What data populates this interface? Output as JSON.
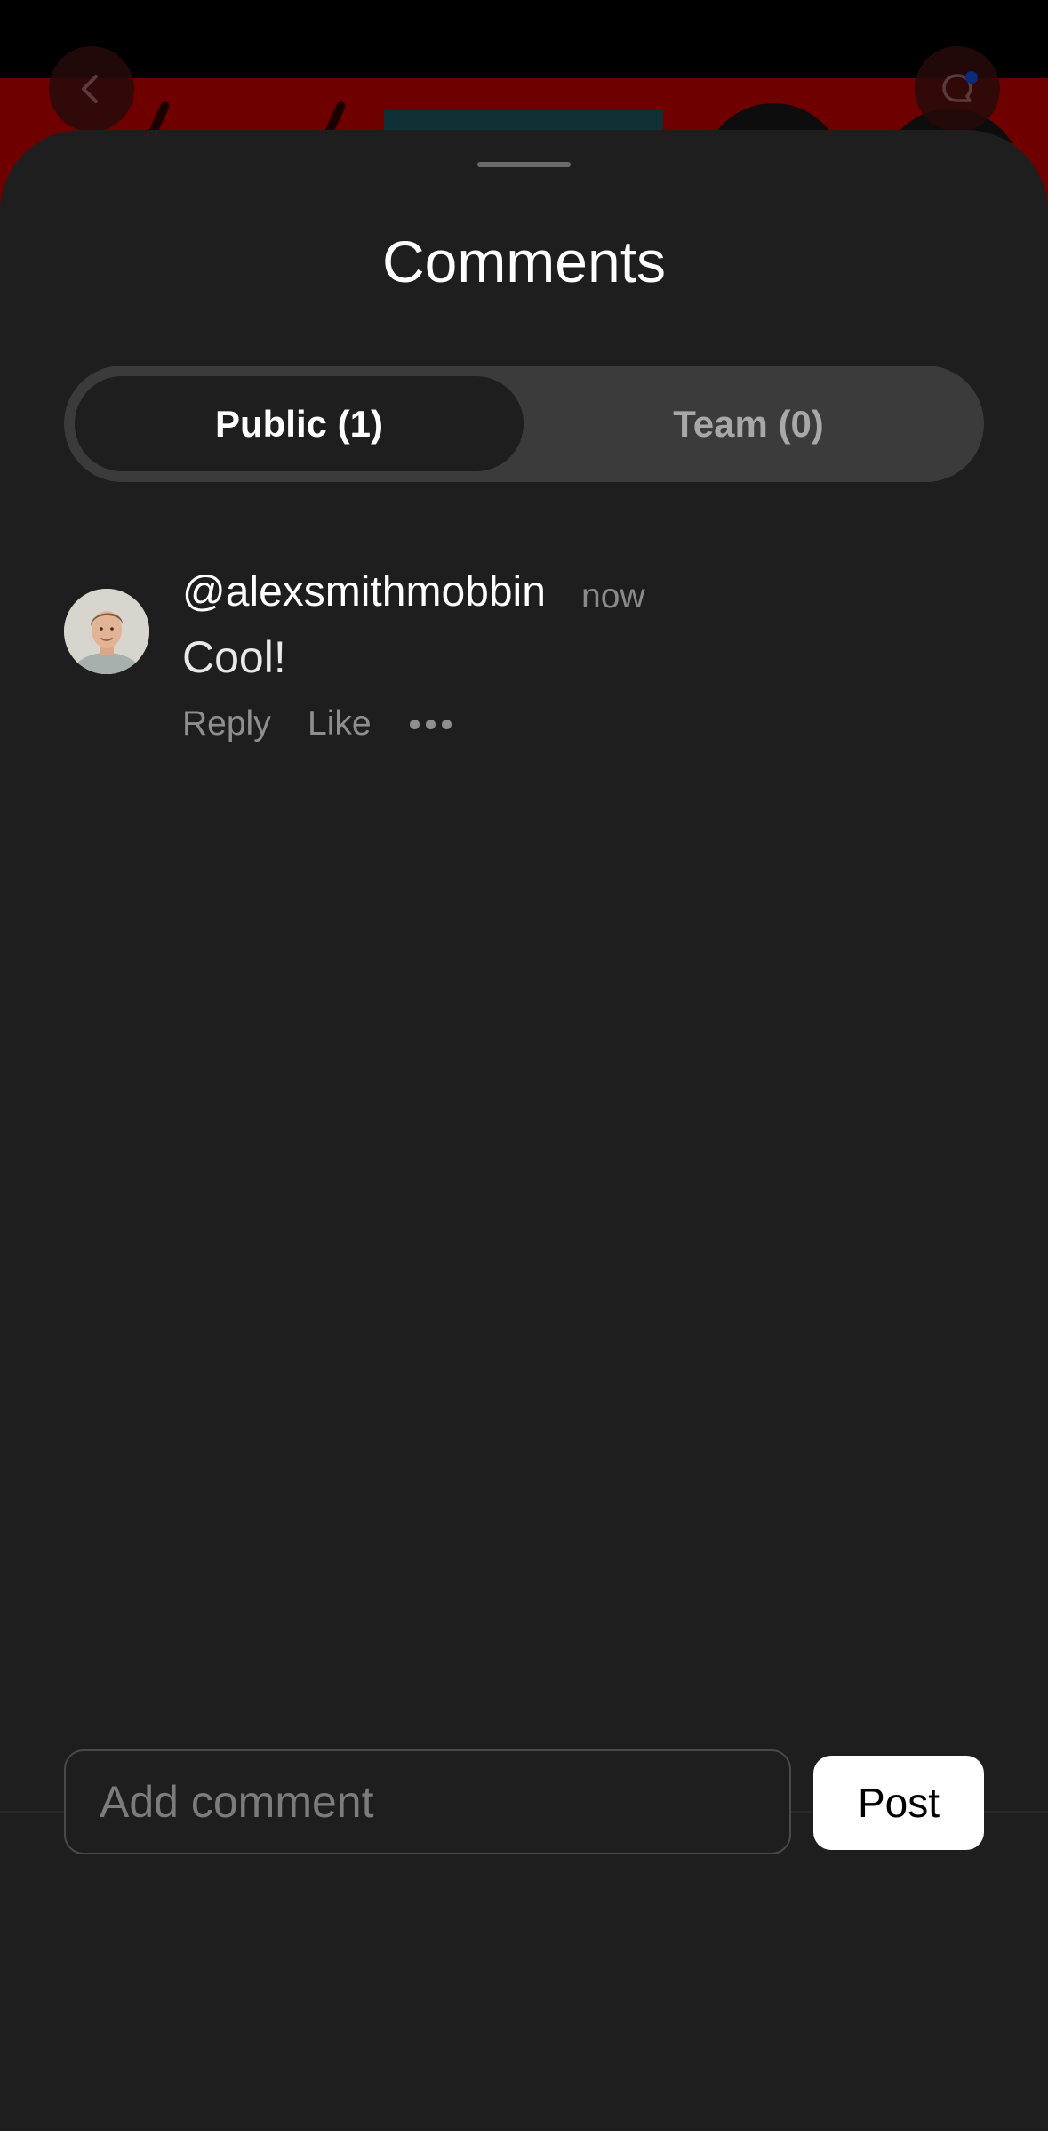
{
  "sheet": {
    "title": "Comments"
  },
  "tabs": [
    {
      "label": "Public (1)",
      "active": true
    },
    {
      "label": "Team (0)",
      "active": false
    }
  ],
  "comments": [
    {
      "username": "@alexsmithmobbin",
      "time": "now",
      "text": "Cool!",
      "actions": {
        "reply": "Reply",
        "like": "Like"
      }
    }
  ],
  "composer": {
    "placeholder": "Add comment",
    "post_label": "Post"
  },
  "icons": {
    "back": "chevron-left-icon",
    "comment": "chat-bubble-icon",
    "more": "more-horizontal-icon"
  },
  "colors": {
    "sheet_bg": "#1e1e1e",
    "segment_bg": "#3b3b3b",
    "hero_bg": "#6e0000",
    "post_button": "#ffffff"
  }
}
